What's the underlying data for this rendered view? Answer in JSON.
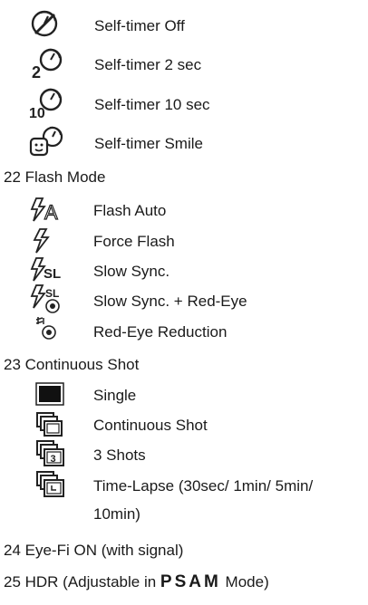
{
  "self_timer": {
    "items": [
      {
        "label": "Self-timer Off",
        "icon": "self-timer-off-icon"
      },
      {
        "label": "Self-timer 2 sec",
        "icon": "self-timer-2-icon"
      },
      {
        "label": "Self-timer 10 sec",
        "icon": "self-timer-10-icon"
      },
      {
        "label": "Self-timer Smile",
        "icon": "self-timer-smile-icon"
      }
    ]
  },
  "flash": {
    "heading": "22 Flash Mode",
    "items": [
      {
        "label": "Flash Auto",
        "icon": "flash-auto-icon",
        "glyph": "A"
      },
      {
        "label": "Force Flash",
        "icon": "force-flash-icon"
      },
      {
        "label": "Slow Sync.",
        "icon": "slow-sync-icon",
        "glyph": "SL"
      },
      {
        "label": "Slow Sync. + Red-Eye",
        "icon": "slow-sync-red-eye-icon",
        "glyph": "SL"
      },
      {
        "label": "Red-Eye Reduction",
        "icon": "red-eye-reduction-icon"
      }
    ]
  },
  "continuous": {
    "heading": "23 Continuous Shot",
    "items": [
      {
        "label": "Single",
        "icon": "single-shot-icon"
      },
      {
        "label": "Continuous Shot",
        "icon": "continuous-shot-icon"
      },
      {
        "label": "3 Shots",
        "icon": "three-shots-icon",
        "glyph": "3"
      },
      {
        "label_line1": "Time-Lapse (30sec/ 1min/ 5min/",
        "label_line2": "10min)",
        "icon": "time-lapse-icon"
      }
    ]
  },
  "eye_fi": {
    "heading": "24 Eye-Fi ON (with signal)"
  },
  "hdr": {
    "prefix": "25 HDR (Adjustable in ",
    "modes": "PSAM",
    "suffix": " Mode)"
  }
}
